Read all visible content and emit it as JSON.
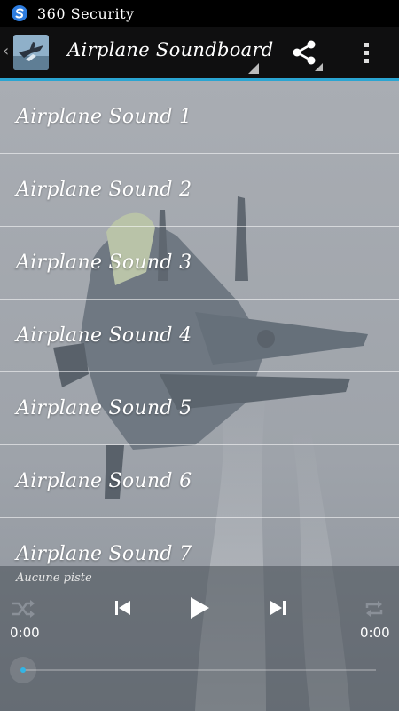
{
  "status_bar": {
    "app_name": "360 Security"
  },
  "action_bar": {
    "title": "Airplane Soundboard"
  },
  "sounds": [
    {
      "label": "Airplane Sound 1"
    },
    {
      "label": "Airplane Sound 2"
    },
    {
      "label": "Airplane Sound 3"
    },
    {
      "label": "Airplane Sound 4"
    },
    {
      "label": "Airplane Sound 5"
    },
    {
      "label": "Airplane Sound 6"
    },
    {
      "label": "Airplane Sound 7"
    }
  ],
  "player": {
    "track_label": "Aucune piste",
    "elapsed": "0:00",
    "duration": "0:00",
    "progress": 0
  },
  "colors": {
    "accent": "#2aa5d2",
    "seek_dot": "#33b5e5"
  }
}
